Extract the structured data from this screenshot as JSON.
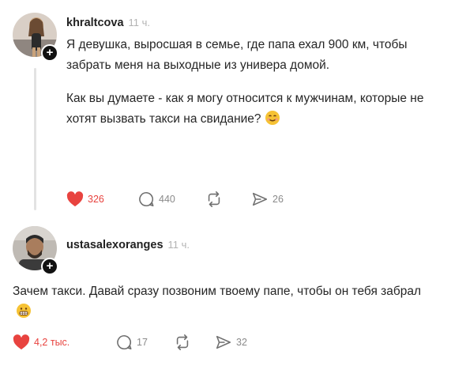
{
  "posts": [
    {
      "username": "khraltcova",
      "time": "11 ч.",
      "paragraphs": [
        "Я девушка, выросшая в семье, где папа ехал 900 км, чтобы забрать меня на выходные из универа домой.",
        "Как вы думаете - как я могу относится к мужчинам, которые не хотят вызвать такси на свидание?"
      ],
      "emoji": "smiling-face-icon",
      "likes": "326",
      "comments": "440",
      "reposts": "",
      "shares": "26"
    },
    {
      "username": "ustasalexoranges",
      "time": "11 ч.",
      "paragraphs": [
        "Зачем такси. Давай сразу позвоним твоему папе, чтобы он тебя забрал"
      ],
      "emoji": "grimacing-face-icon",
      "likes": "4,2 тыс.",
      "comments": "17",
      "reposts": "",
      "shares": "32"
    }
  ],
  "colors": {
    "like": "#e8433f",
    "muted": "#8a8a8a",
    "line": "#e3e3e3"
  }
}
